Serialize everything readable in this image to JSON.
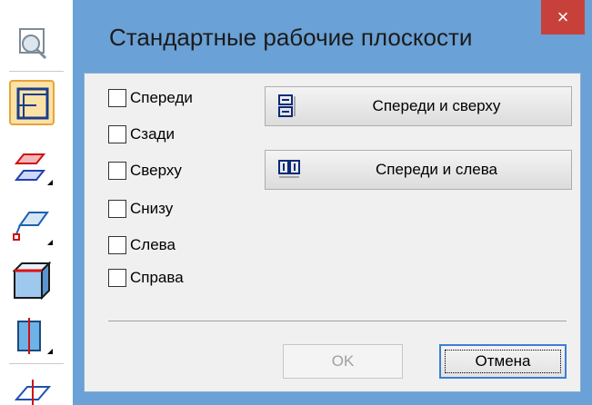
{
  "dialog": {
    "title": "Стандартные рабочие плоскости",
    "close_glyph": "×"
  },
  "checkboxes": [
    {
      "label": "Спереди",
      "checked": false
    },
    {
      "label": "Сзади",
      "checked": false
    },
    {
      "label": "Сверху",
      "checked": false
    },
    {
      "label": "Снизу",
      "checked": false
    },
    {
      "label": "Слева",
      "checked": false
    },
    {
      "label": "Справа",
      "checked": false
    }
  ],
  "buttons": {
    "front_top": "Спереди и сверху",
    "front_left": "Спереди и слева",
    "ok": "OK",
    "cancel": "Отмена"
  },
  "toolbar": {
    "items": [
      "zoom-icon",
      "front-view-icon",
      "planes-icon",
      "plane-point-icon",
      "box-icon",
      "cylinder-section-icon",
      "axis-plane-icon"
    ]
  },
  "colors": {
    "title_bar": "#6aa1d6",
    "close_button": "#c7413a",
    "active_tool": "#fbe2a6"
  }
}
